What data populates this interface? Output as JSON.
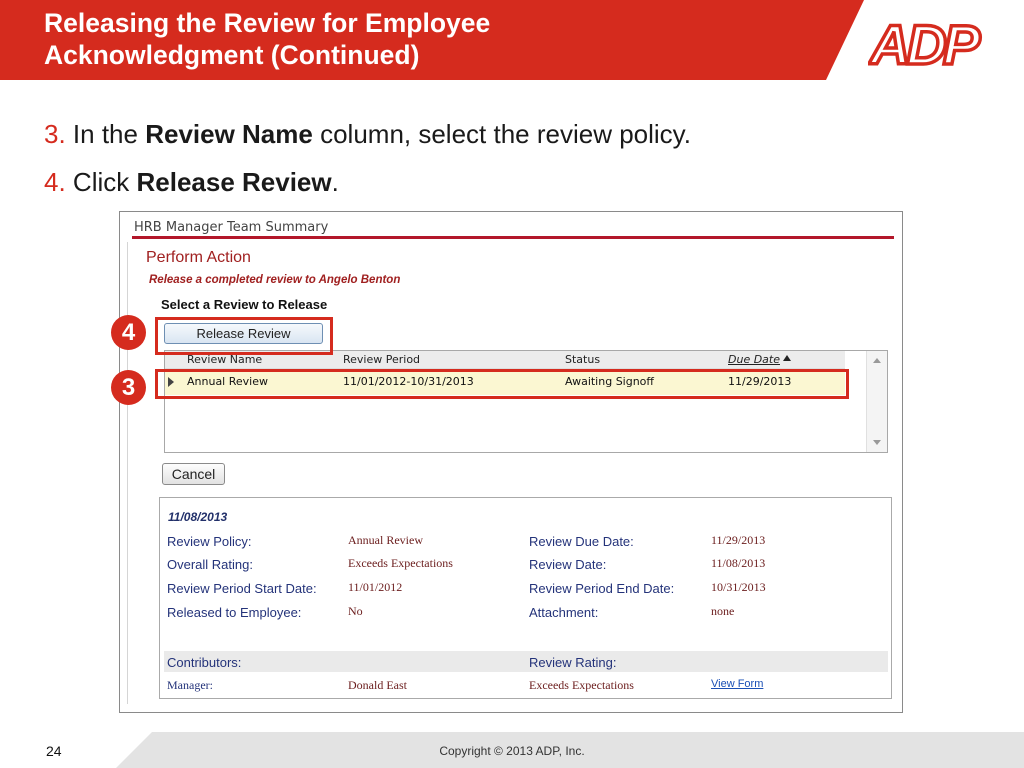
{
  "slide": {
    "title_line1": "Releasing the Review for Employee",
    "title_line2": "Acknowledgment (Continued)",
    "logo_text": "ADP",
    "accent_color": "#d52b1e"
  },
  "steps": [
    {
      "num": "3.",
      "pre": "In the ",
      "bold": "Review Name",
      "post": " column, select the review policy."
    },
    {
      "num": "4.",
      "pre": "Click ",
      "bold": "Release Review",
      "post": "."
    }
  ],
  "screen": {
    "app_title": "HRB Manager Team Summary",
    "section_title": "Perform Action",
    "subtitle": "Release a completed review to Angelo Benton",
    "select_heading": "Select a Review to Release",
    "release_button": "Release Review",
    "cancel_button": "Cancel",
    "table": {
      "columns": [
        "Review Name",
        "Review Period",
        "Status",
        "Due Date"
      ],
      "rows": [
        {
          "name": "Annual Review",
          "period": "11/01/2012-10/31/2013",
          "status": "Awaiting Signoff",
          "due": "11/29/2013"
        }
      ]
    },
    "details": {
      "date": "11/08/2013",
      "review_policy_label": "Review Policy:",
      "review_policy": "Annual Review",
      "overall_rating_label": "Overall Rating:",
      "overall_rating": "Exceeds Expectations",
      "period_start_label": "Review Period Start Date:",
      "period_start": "11/01/2012",
      "released_label": "Released to Employee:",
      "released": "No",
      "due_date_label": "Review Due Date:",
      "due_date": "11/29/2013",
      "review_date_label": "Review Date:",
      "review_date": "11/08/2013",
      "period_end_label": "Review Period End Date:",
      "period_end": "10/31/2013",
      "attachment_label": "Attachment:",
      "attachment": "none",
      "contributors_label": "Contributors:",
      "review_rating_label": "Review Rating:",
      "manager_label": "Manager:",
      "manager": "Donald East",
      "manager_rating": "Exceeds Expectations",
      "view_form": "View Form"
    }
  },
  "callouts": {
    "release": "4",
    "row": "3"
  },
  "footer": {
    "page": "24",
    "copyright": "Copyright © 2013 ADP, Inc."
  }
}
